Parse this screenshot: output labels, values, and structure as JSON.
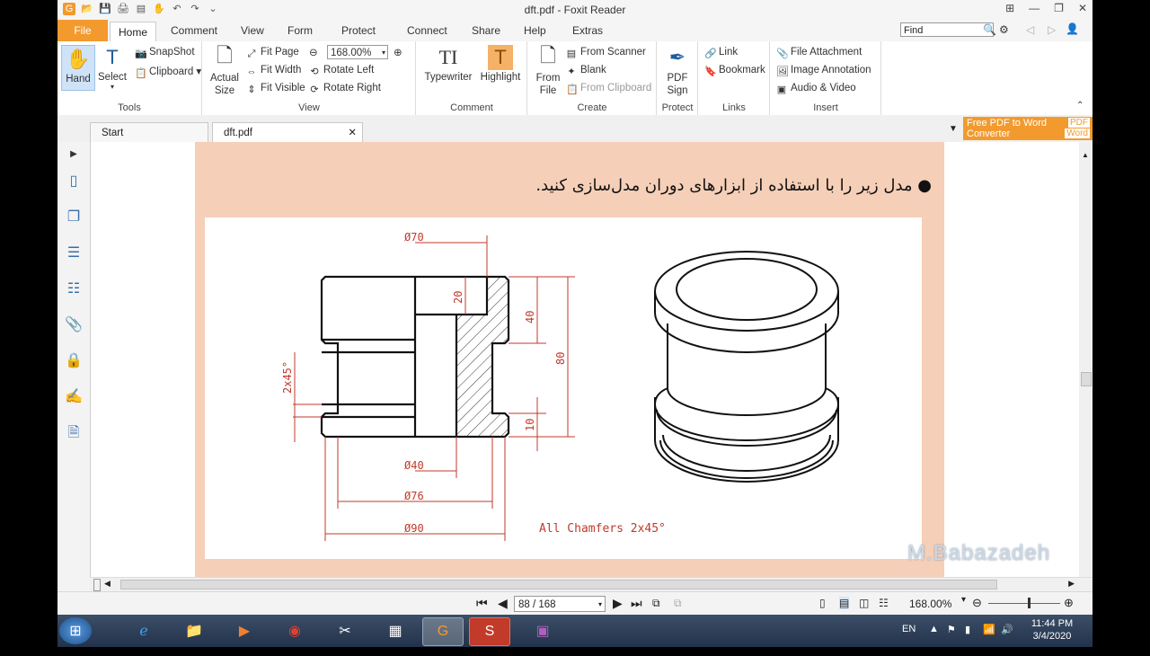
{
  "window": {
    "title": "dft.pdf - Foxit Reader"
  },
  "menu": {
    "file": "File",
    "home": "Home",
    "tabs": [
      "Comment",
      "View",
      "Form",
      "Protect",
      "Connect",
      "Share",
      "Help",
      "Extras"
    ]
  },
  "find": {
    "placeholder": "Find"
  },
  "ribbon": {
    "tools": {
      "label": "Tools",
      "hand": "Hand",
      "select": "Select",
      "snapshot": "SnapShot",
      "clipboard": "Clipboard"
    },
    "view": {
      "label": "View",
      "actual_size": "Actual Size",
      "fit_page": "Fit Page",
      "fit_width": "Fit Width",
      "fit_visible": "Fit Visible",
      "zoom": "168.00%",
      "rotate_left": "Rotate Left",
      "rotate_right": "Rotate Right"
    },
    "comment": {
      "label": "Comment",
      "typewriter": "Typewriter",
      "highlight": "Highlight"
    },
    "create": {
      "label": "Create",
      "from_file": "From File",
      "from_scanner": "From Scanner",
      "blank": "Blank",
      "from_clipboard": "From Clipboard"
    },
    "protect": {
      "label": "Protect",
      "pdf_sign": "PDF Sign"
    },
    "links": {
      "label": "Links",
      "link": "Link",
      "bookmark": "Bookmark"
    },
    "insert": {
      "label": "Insert",
      "file_attachment": "File Attachment",
      "image_annotation": "Image Annotation",
      "audio_video": "Audio & Video"
    }
  },
  "tabs": {
    "start": "Start",
    "doc": "dft.pdf"
  },
  "promo": {
    "line1": "Free PDF to Word",
    "line2": "Converter",
    "badge1": "PDF",
    "badge2": "Word"
  },
  "page": {
    "instruction": "مدل زیر را با استفاده از ابزارهای دوران مدل‌سازی کنید.",
    "dims": {
      "d70": "Ø70",
      "d40": "Ø40",
      "d76": "Ø76",
      "d90": "Ø90",
      "h20": "20",
      "h40": "40",
      "h80": "80",
      "h10": "10",
      "chamfer_side": "2x45°"
    },
    "note": "All Chamfers 2x45°"
  },
  "status": {
    "page": "88 / 168",
    "zoom": "168.00%"
  },
  "watermark": "M.Babazadeh",
  "taskbar": {
    "lang": "EN",
    "time": "11:44 PM",
    "date": "3/4/2020"
  },
  "colors": {
    "accent": "#f29a2e",
    "page_band": "#f5cfb8",
    "dim_red": "#c0392b"
  }
}
